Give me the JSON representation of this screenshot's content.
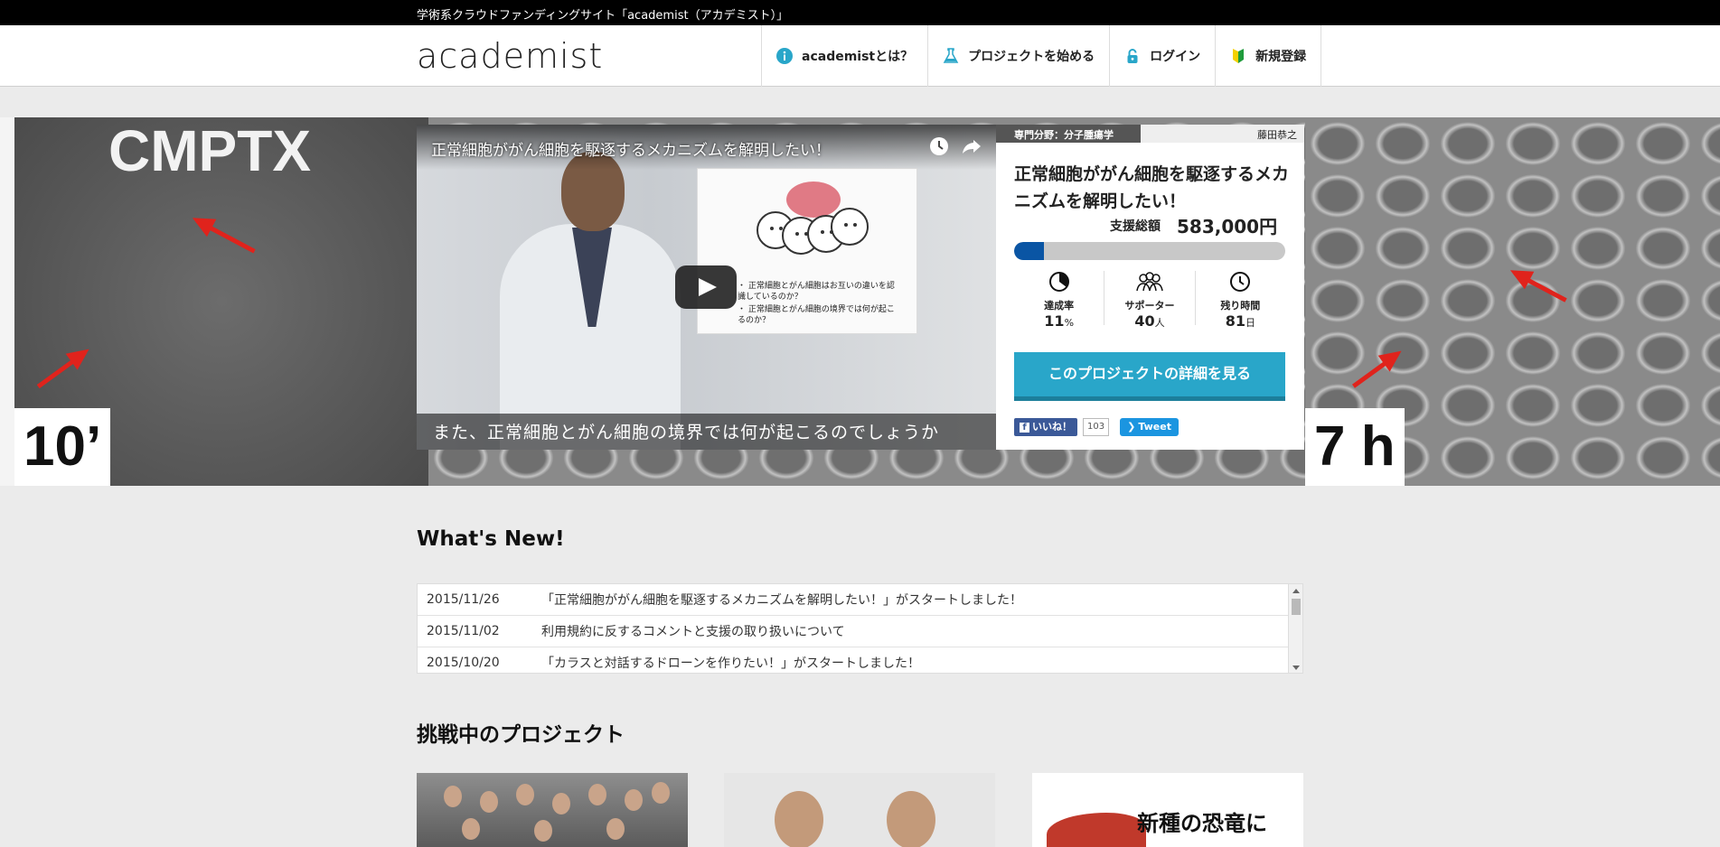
{
  "topbar": {
    "tagline": "学術系クラウドファンディングサイト「academist（アカデミスト）」"
  },
  "header": {
    "logo": "academist",
    "nav": [
      {
        "label": "academistとは？",
        "icon": "info-icon"
      },
      {
        "label": "プロジェクトを始める",
        "icon": "flask-icon"
      },
      {
        "label": "ログイン",
        "icon": "lock-icon"
      },
      {
        "label": "新規登録",
        "icon": "beginner-mark-icon"
      }
    ]
  },
  "hero": {
    "left_image_text": "CMPTX",
    "left_image_label": "10’",
    "right_image_label": "7 h",
    "video": {
      "title": "正常細胞ががん細胞を駆逐するメカニズムを解明したい！",
      "slide_bullets": [
        "・ 正常細胞とがん細胞はお互いの違いを認識しているのか？",
        "・ 正常細胞とがん細胞の境界では何が起こるのか？"
      ],
      "subtitle": "また、正常細胞とがん細胞の境界では何が起こるのでしょうか"
    },
    "project": {
      "field": "専門分野：分子腫瘍学",
      "author": "藤田恭之",
      "title": "正常細胞ががん細胞を駆逐するメカニズムを解明したい！",
      "total_label": "支援総額",
      "total_value": "583,000円",
      "progress_fraction": 0.11,
      "stats": [
        {
          "label": "達成率",
          "value": "11",
          "unit": "%",
          "icon": "pie-icon"
        },
        {
          "label": "サポーター",
          "value": "40",
          "unit": "人",
          "icon": "people-icon"
        },
        {
          "label": "残り時間",
          "value": "81",
          "unit": "日",
          "icon": "clock-icon"
        }
      ],
      "detail_button": "このプロジェクトの詳細を見る",
      "fb_like": "いいね！",
      "fb_count": "103",
      "tweet": "Tweet"
    }
  },
  "whats_new": {
    "title": "What's New!",
    "items": [
      {
        "date": "2015/11/26",
        "text": "「正常細胞ががん細胞を駆逐するメカニズムを解明したい！」がスタートしました！"
      },
      {
        "date": "2015/11/02",
        "text": "利用規約に反するコメントと支援の取り扱いについて"
      },
      {
        "date": "2015/10/20",
        "text": "「カラスと対話するドローンを作りたい！」がスタートしました！"
      }
    ]
  },
  "projects": {
    "title": "挑戦中のプロジェクト",
    "third_card_text": "新種の恐竜に"
  },
  "colors": {
    "accent": "#29a6c9",
    "progress": "#0a55a4",
    "facebook": "#3b5998",
    "twitter": "#1b95e0"
  }
}
